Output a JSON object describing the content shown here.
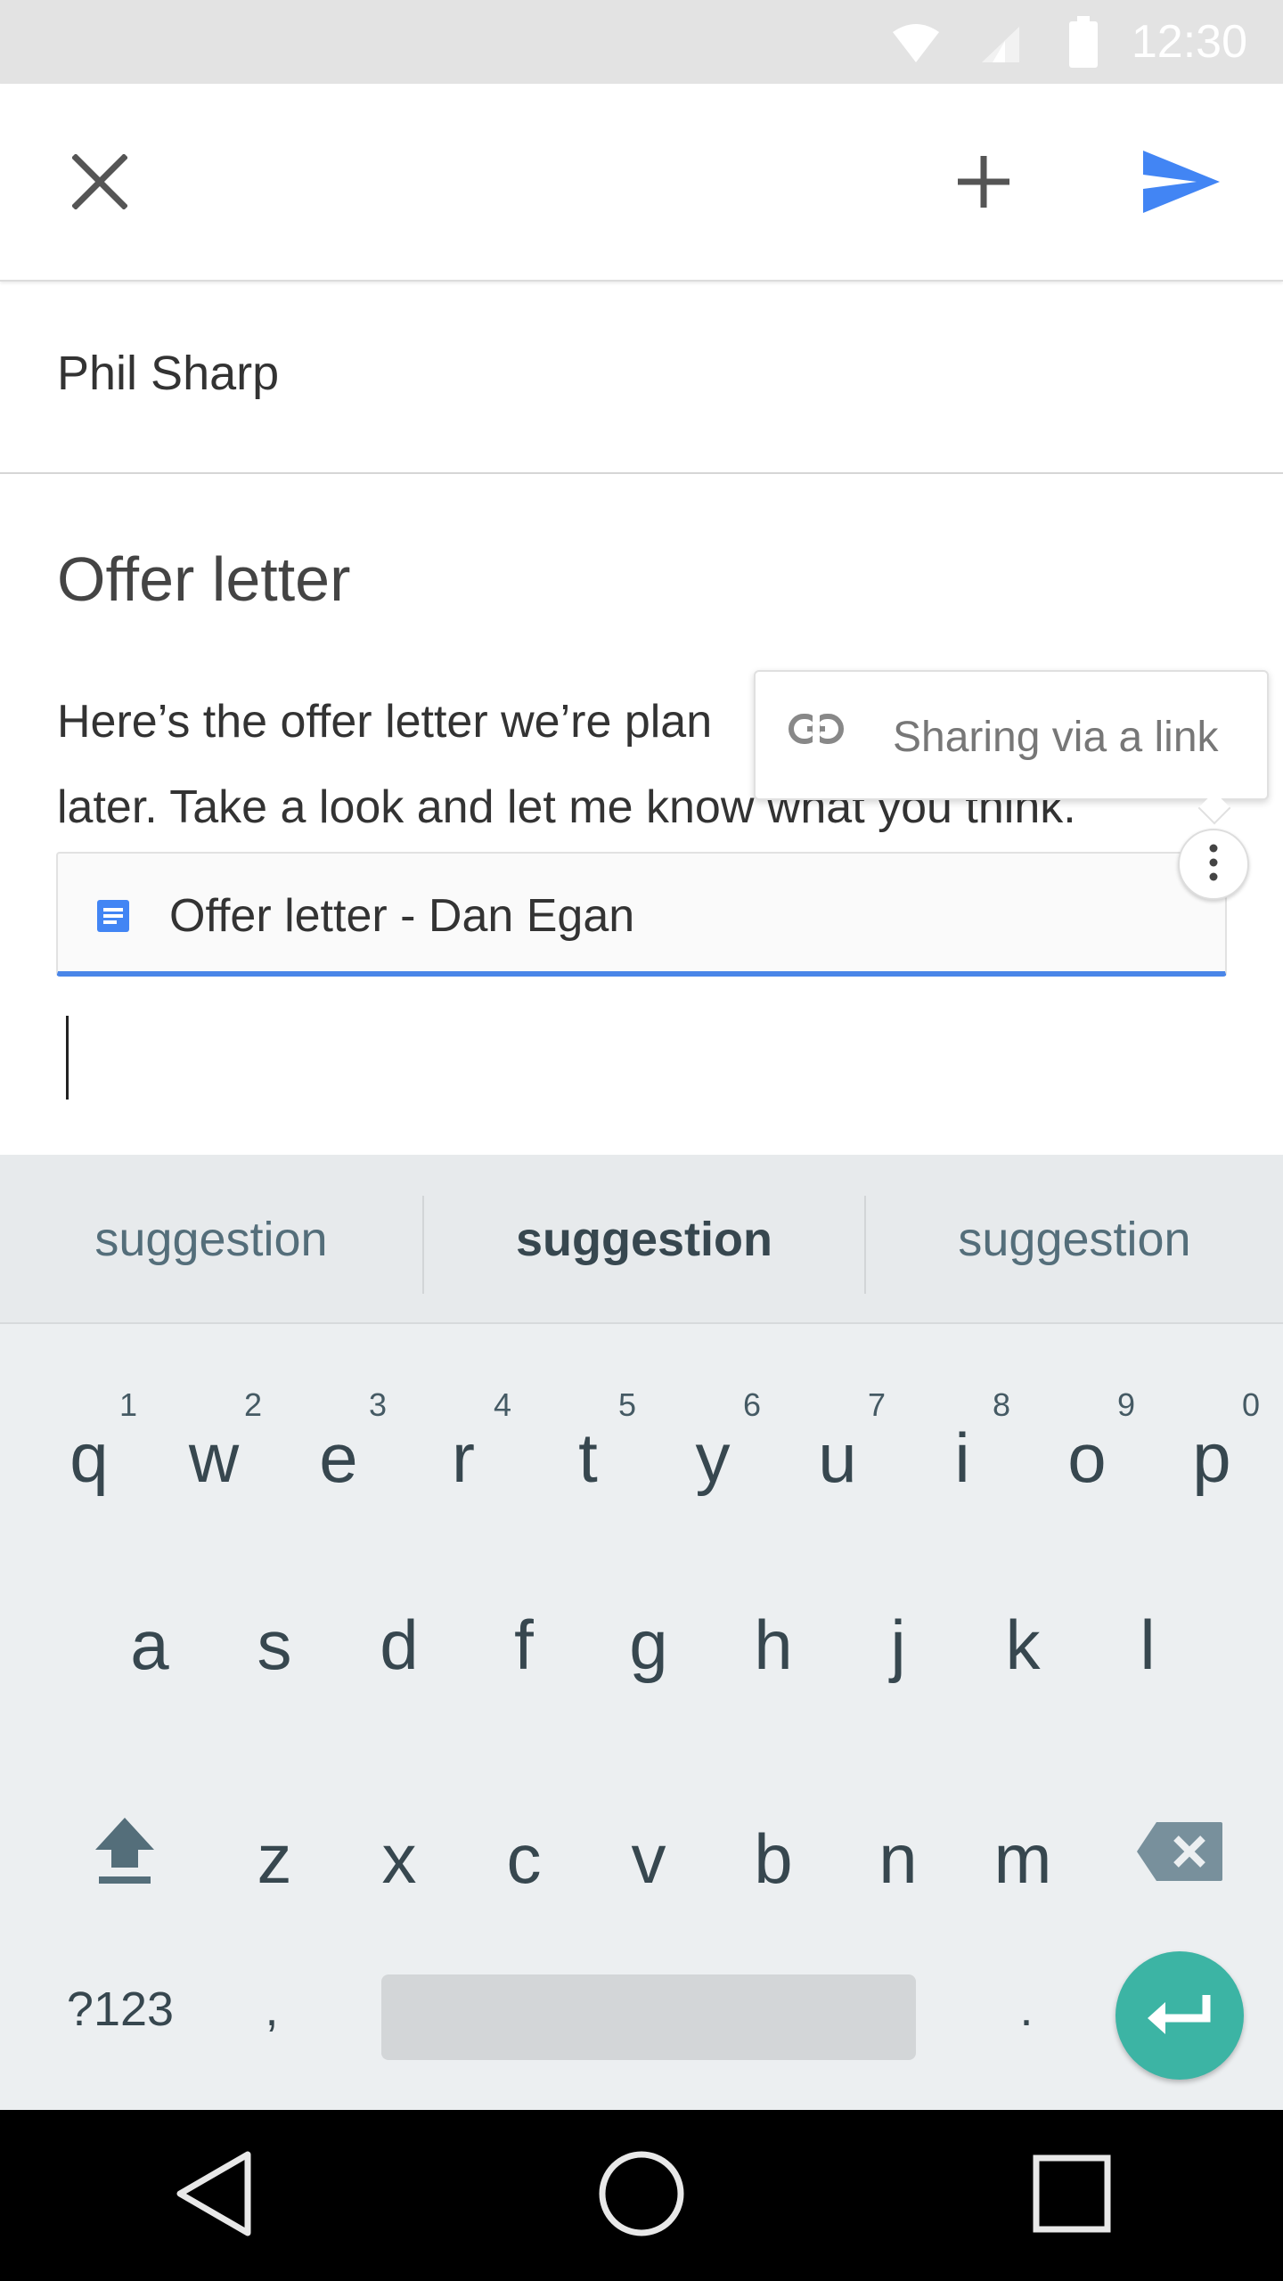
{
  "status_bar": {
    "time": "12:30",
    "icons": [
      "wifi-icon",
      "signal-icon",
      "battery-icon"
    ]
  },
  "toolbar": {
    "close_icon": "close-icon",
    "attach_icon": "plus-icon",
    "send_icon": "send-icon"
  },
  "compose": {
    "to": "Phil Sharp",
    "subject": "Offer letter",
    "body_line1": "Here’s the offer letter we’re plan",
    "body_line2": "later.  Take a look and let me know what you think."
  },
  "attachment": {
    "label": "Offer letter - Dan Egan",
    "icon": "doc-icon"
  },
  "tooltip": {
    "label": "Sharing via a link",
    "icon": "link-icon"
  },
  "keyboard": {
    "suggestions": [
      "suggestion",
      "suggestion",
      "suggestion"
    ],
    "row1": [
      {
        "k": "q",
        "h": "1"
      },
      {
        "k": "w",
        "h": "2"
      },
      {
        "k": "e",
        "h": "3"
      },
      {
        "k": "r",
        "h": "4"
      },
      {
        "k": "t",
        "h": "5"
      },
      {
        "k": "y",
        "h": "6"
      },
      {
        "k": "u",
        "h": "7"
      },
      {
        "k": "i",
        "h": "8"
      },
      {
        "k": "o",
        "h": "9"
      },
      {
        "k": "p",
        "h": "0"
      }
    ],
    "row2": [
      "a",
      "s",
      "d",
      "f",
      "g",
      "h",
      "j",
      "k",
      "l"
    ],
    "row3": [
      "z",
      "x",
      "c",
      "v",
      "b",
      "n",
      "m"
    ],
    "symbols_key": "?123",
    "comma_key": ",",
    "period_key": ".",
    "accent_color": "#3cb4a4"
  },
  "colors": {
    "send": "#4285f4",
    "attachment_underline": "#4a86e8"
  }
}
